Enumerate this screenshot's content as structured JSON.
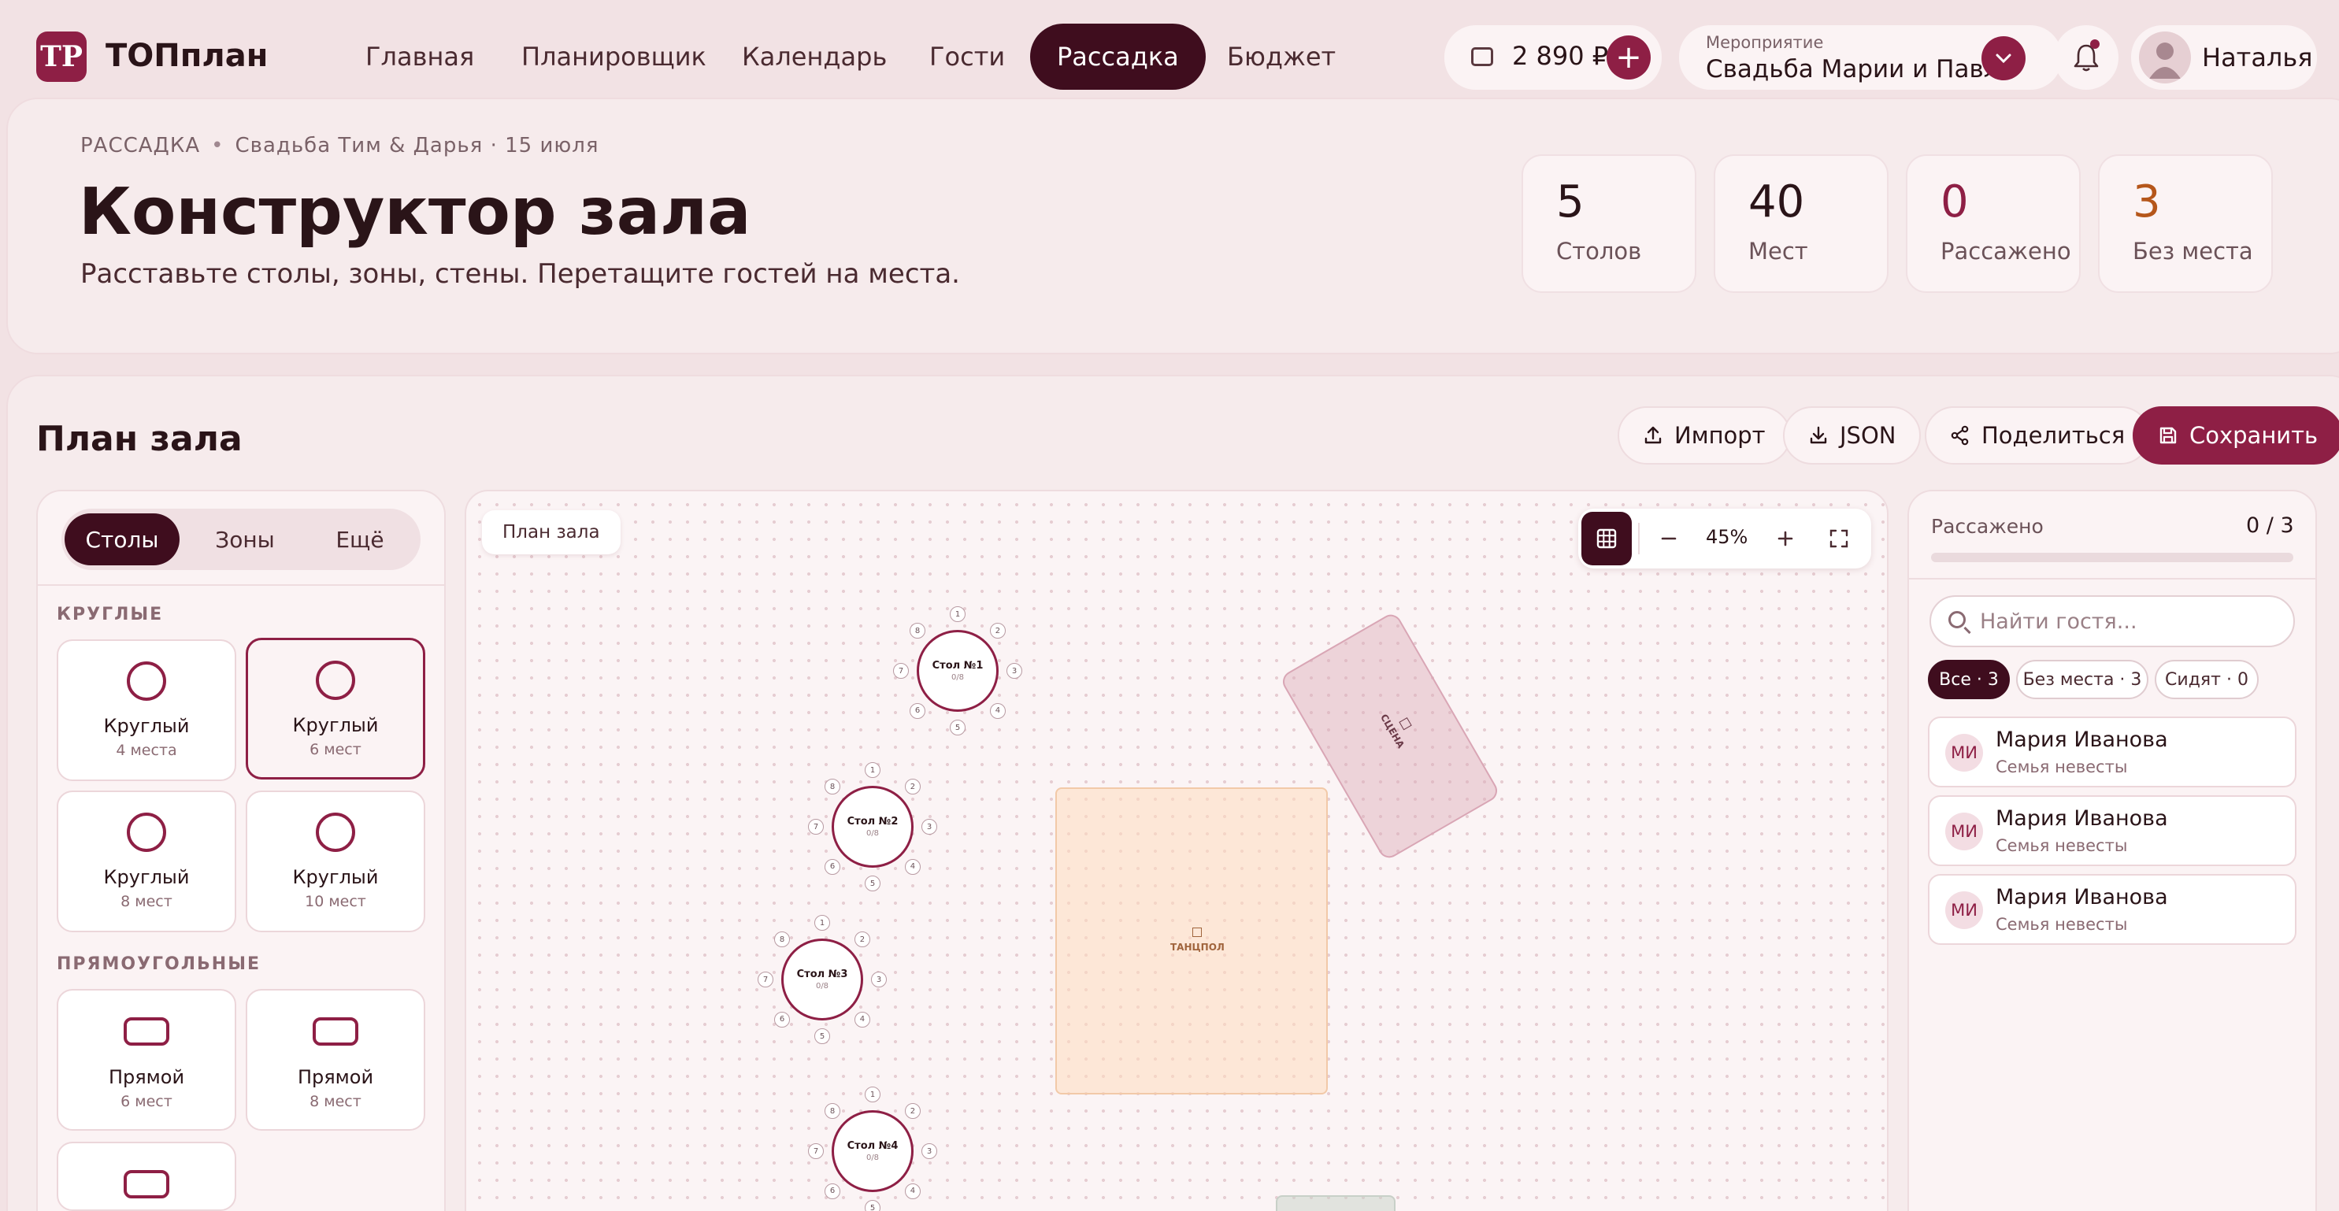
{
  "app": {
    "brand": "ТОПплан",
    "logo_text": "ТР"
  },
  "nav": {
    "items": [
      "Главная",
      "Планировщик",
      "Календарь",
      "Гости",
      "Рассадка",
      "Бюджет"
    ],
    "active": "Рассадка"
  },
  "wallet": {
    "amount": "2 890 ₽",
    "add_label": "+"
  },
  "event": {
    "label": "Мероприятие",
    "value": "Свадьба Марии и Павла"
  },
  "user": {
    "name": "Наталья"
  },
  "header": {
    "breadcrumb_section": "РАССАДКА",
    "breadcrumb_event": "Свадьба Тим & Дарья · 15 июля",
    "title": "Конструктор зала",
    "subtitle": "Расставьте столы, зоны, стены. Перетащите гостей на места."
  },
  "stats": [
    {
      "value": "5",
      "label": "Столов",
      "color": "#2a1418"
    },
    {
      "value": "40",
      "label": "Мест",
      "color": "#2a1418"
    },
    {
      "value": "0",
      "label": "Рассажено",
      "color": "#8e1f45"
    },
    {
      "value": "3",
      "label": "Без места",
      "color": "#b5561a"
    }
  ],
  "plan": {
    "title": "План зала",
    "actions": {
      "import": "Импорт",
      "json": "JSON",
      "share": "Поделиться",
      "save": "Сохранить"
    }
  },
  "library": {
    "tabs": [
      "Столы",
      "Зоны",
      "Ещё"
    ],
    "round_section": "КРУГЛЫЕ",
    "round": [
      {
        "name": "Круглый",
        "seats": "4 места"
      },
      {
        "name": "Круглый",
        "seats": "6 мест"
      },
      {
        "name": "Круглый",
        "seats": "8 мест"
      },
      {
        "name": "Круглый",
        "seats": "10 мест"
      }
    ],
    "rect_section": "ПРЯМОУГОЛЬНЫЕ",
    "rect": [
      {
        "name": "Прямой",
        "seats": "6 мест"
      },
      {
        "name": "Прямой",
        "seats": "8 мест"
      }
    ]
  },
  "canvas": {
    "label": "План зала",
    "zoom": "45%",
    "tables": [
      {
        "name": "Стол №1",
        "count": "0/8"
      },
      {
        "name": "Стол №2",
        "count": "0/8"
      },
      {
        "name": "Стол №3",
        "count": "0/8"
      },
      {
        "name": "Стол №4",
        "count": "0/8"
      }
    ],
    "seat_numbers": [
      "1",
      "2",
      "3",
      "4",
      "5",
      "6",
      "7",
      "8"
    ],
    "zones": {
      "dance": "ТАНЦПОЛ",
      "stage": "СЦЕНА"
    }
  },
  "guests_panel": {
    "seated_label": "Рассажено",
    "seated_value": "0 / 3",
    "seated_progress": 0,
    "search_placeholder": "Найти гостя...",
    "filters": [
      "Все · 3",
      "Без места · 3",
      "Сидят · 0"
    ],
    "guests": [
      {
        "initials": "МИ",
        "name": "Мария Иванова",
        "group": "Семья невесты"
      },
      {
        "initials": "МИ",
        "name": "Мария Иванова",
        "group": "Семья невесты"
      },
      {
        "initials": "МИ",
        "name": "Мария Иванова",
        "group": "Семья невесты"
      }
    ]
  },
  "colors": {
    "accent": "#8e1f45",
    "dark": "#3f0d1e",
    "background": "#f2e2e4"
  }
}
